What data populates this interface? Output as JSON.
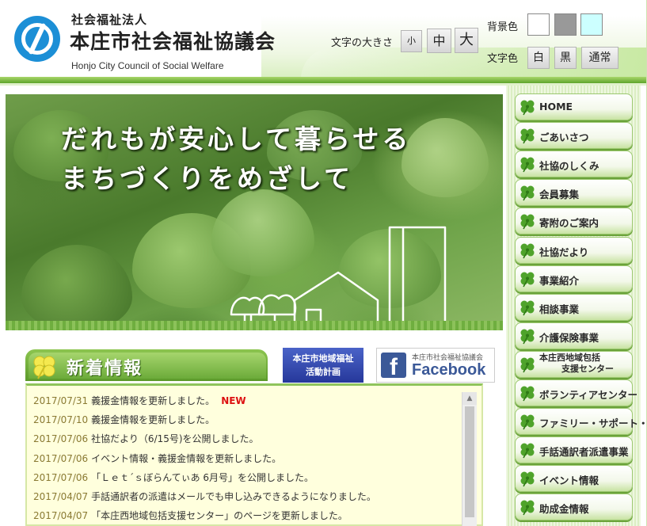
{
  "header": {
    "org_kind": "社会福祉法人",
    "org_name": "本庄市社会福祉協議会",
    "org_name_en": "Honjo City Council of Social Welfare",
    "logo_icon": "social-welfare-logo",
    "font_size": {
      "label": "文字の大きさ",
      "small": "小",
      "medium": "中",
      "large": "大"
    },
    "background_color": {
      "label": "背景色",
      "options": [
        "#ffffff",
        "#999999",
        "#ccffff"
      ]
    },
    "text_color": {
      "label": "文字色",
      "white": "白",
      "black": "黒",
      "normal": "通常"
    }
  },
  "hero": {
    "line1": "だれもが安心して暮らせる",
    "line2": "まちづくりをめざして"
  },
  "news": {
    "title": "新着情報",
    "new_badge": "NEW",
    "items": [
      {
        "date": "2017/07/31",
        "text": "義援金情報を更新しました。",
        "is_new": true
      },
      {
        "date": "2017/07/10",
        "text": "義援金情報を更新しました。",
        "is_new": false
      },
      {
        "date": "2017/07/06",
        "text": "社協だより（6/15号)を公開しました。",
        "is_new": false
      },
      {
        "date": "2017/07/06",
        "text": "イベント情報・義援金情報を更新しました。",
        "is_new": false
      },
      {
        "date": "2017/07/06",
        "text": "「Ｌｅｔ´ｓぼらんてぃあ 6月号」を公開しました。",
        "is_new": false
      },
      {
        "date": "2017/04/07",
        "text": "手話通訳者の派遣はメールでも申し込みできるようになりました。",
        "is_new": false
      },
      {
        "date": "2017/04/07",
        "text": "「本庄西地域包括支援センター」のページを更新しました。",
        "is_new": false
      }
    ]
  },
  "banners": {
    "plan_line1": "本庄市地域福祉",
    "plan_line2": "活動計画",
    "facebook_sub": "本庄市社会福祉協議会",
    "facebook_word": "Facebook"
  },
  "nav": {
    "items": [
      {
        "label": "HOME"
      },
      {
        "label": "ごあいさつ"
      },
      {
        "label": "社協のしくみ"
      },
      {
        "label": "会員募集"
      },
      {
        "label": "寄附のご案内"
      },
      {
        "label": "社協だより"
      },
      {
        "label": "事業紹介"
      },
      {
        "label": "相談事業"
      },
      {
        "label": "介護保険事業"
      },
      {
        "label": "本庄西地域包括",
        "label2": "支援センター"
      },
      {
        "label": "ボランティアセンター"
      },
      {
        "label": "ファミリー・サポート・センター"
      },
      {
        "label": "手話通訳者派遣事業"
      },
      {
        "label": "イベント情報"
      },
      {
        "label": "助成金情報"
      }
    ]
  },
  "colors": {
    "accent_green": "#6cab3a",
    "new_red": "#dd1111",
    "facebook_blue": "#3b5998",
    "plan_blue": "#26389a"
  }
}
